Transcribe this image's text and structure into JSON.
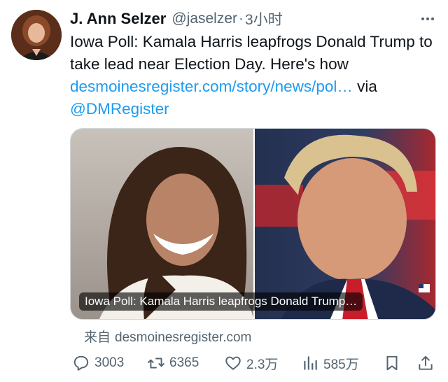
{
  "author": {
    "display_name": "J. Ann Selzer",
    "handle": "@jaselzer",
    "separator": "·",
    "time": "3小时"
  },
  "tweet": {
    "text_part1": "Iowa Poll: Kamala Harris leapfrogs Donald Trump to take lead near Election Day. Here's how ",
    "link": "desmoinesregister.com/story/news/pol…",
    "text_part2": " via ",
    "mention": "@DMRegister"
  },
  "card": {
    "caption": "Iowa Poll: Kamala Harris leapfrogs Donald Trump…",
    "source_prefix": "来自",
    "source_domain": "desmoinesregister.com"
  },
  "actions": {
    "replies": "3003",
    "retweets": "6365",
    "likes": "2.3万",
    "views": "585万"
  },
  "icons": [
    "more-icon",
    "reply-icon",
    "retweet-icon",
    "like-icon",
    "views-icon",
    "bookmark-icon",
    "share-icon"
  ],
  "colors": {
    "link": "#1d9bf0",
    "muted": "#536471",
    "text": "#0f1419"
  }
}
